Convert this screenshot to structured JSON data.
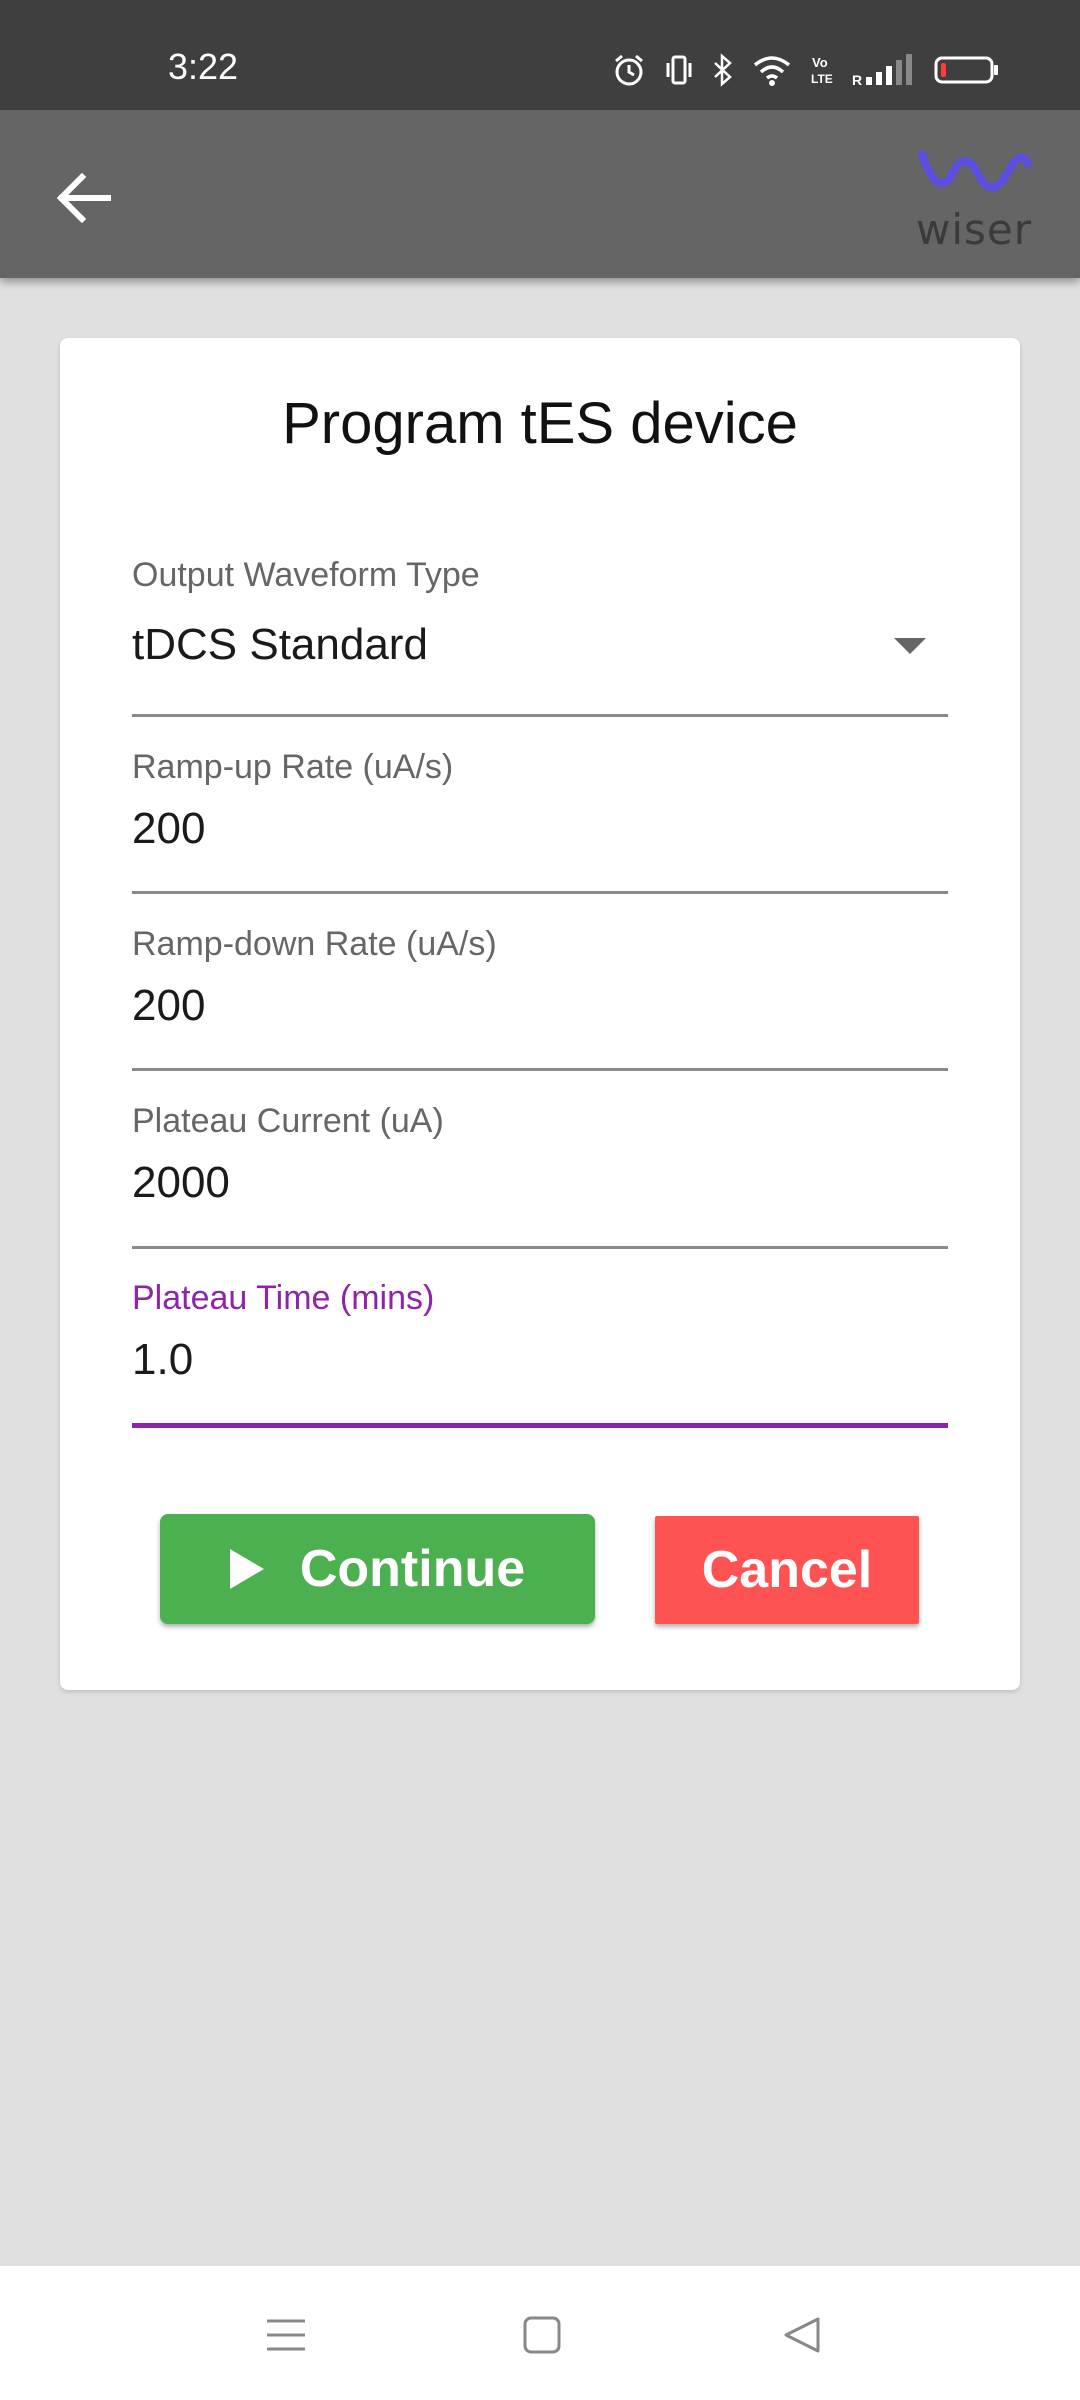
{
  "status_bar": {
    "time": "3:22",
    "icons": [
      "alarm-icon",
      "vibrate-icon",
      "bluetooth-icon",
      "wifi-icon",
      "volte-icon",
      "signal-icon",
      "battery-icon"
    ],
    "lte_label": "LTE",
    "vo_label": "Vo",
    "roaming_label": "R"
  },
  "app_bar": {
    "back_icon": "arrow-left-icon",
    "logo_text": "wiser",
    "logo_color": "#5b4fe0"
  },
  "card": {
    "title": "Program tES device",
    "fields": [
      {
        "label": "Output Waveform Type",
        "value": "tDCS Standard",
        "type": "dropdown"
      },
      {
        "label": "Ramp-up Rate (uA/s)",
        "value": "200",
        "type": "input"
      },
      {
        "label": "Ramp-down Rate (uA/s)",
        "value": "200",
        "type": "input"
      },
      {
        "label": "Plateau Current (uA)",
        "value": "2000",
        "type": "input"
      },
      {
        "label": "Plateau Time (mins)",
        "value": "1.0",
        "type": "input",
        "focused": true
      }
    ],
    "continue_label": "Continue",
    "cancel_label": "Cancel"
  },
  "colors": {
    "accent": "#8e24aa",
    "continue": "#4caf50",
    "cancel": "#ff5252"
  },
  "nav_bar": {
    "icons": [
      "menu-icon",
      "home-square-icon",
      "back-triangle-icon"
    ]
  }
}
